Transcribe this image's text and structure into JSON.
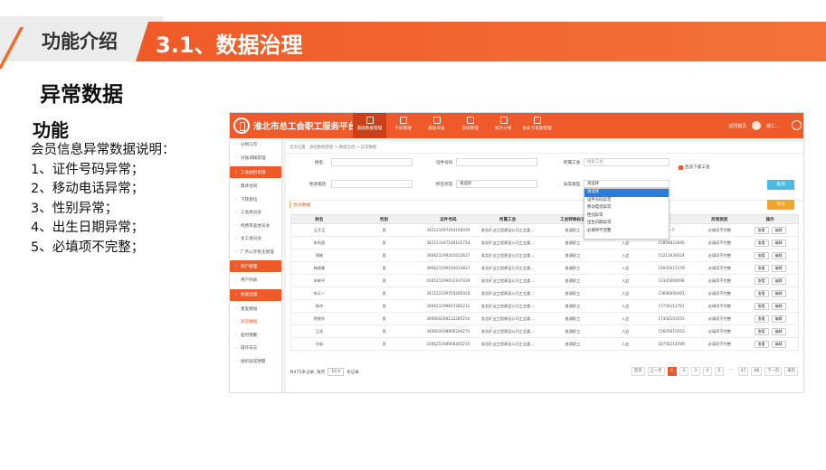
{
  "slide": {
    "section_label": "功能介绍",
    "section_title": "3.1、数据治理",
    "page_heading": "异常数据",
    "func_heading": "功能",
    "func_lines": [
      "会员信息异常数据说明：",
      "1、证件号码异常；",
      "2、移动电话异常；",
      "3、性别异常；",
      "4、出生日期异常；",
      "5、必填项不完整；"
    ]
  },
  "app": {
    "name": "淮北市总工会职工服务平台",
    "nav": [
      "基础数据管理",
      "干部管理",
      "基层单位",
      "活动管理",
      "统计分析",
      "会员卡发放管理"
    ],
    "nav_active": 0,
    "top_right": {
      "home": "返回首页",
      "user": "颜仁..."
    },
    "sidebar": [
      {
        "label": "分税工作",
        "type": "item"
      },
      {
        "label": "对账调拨管理",
        "type": "item"
      },
      {
        "label": "工会组织管理",
        "type": "head"
      },
      {
        "label": "集体合同",
        "type": "item"
      },
      {
        "label": "下辖单位",
        "type": "item"
      },
      {
        "label": "工会委员会",
        "type": "item"
      },
      {
        "label": "经费审查委员会",
        "type": "item"
      },
      {
        "label": "女工委员会",
        "type": "item"
      },
      {
        "label": "厂务公开民主管理",
        "type": "item"
      },
      {
        "label": "用户管理",
        "type": "head"
      },
      {
        "label": "用户列表",
        "type": "item"
      },
      {
        "label": "数据治理",
        "type": "head"
      },
      {
        "label": "重复数据",
        "type": "item"
      },
      {
        "label": "异常数据",
        "type": "current"
      },
      {
        "label": "超时预警",
        "type": "item"
      },
      {
        "label": "操作日志",
        "type": "item"
      },
      {
        "label": "组织异常预警",
        "type": "item"
      }
    ],
    "breadcrumb": "首页位置：基础数据管理 > 数据治理 > 异常数据",
    "form": {
      "name_label": "姓名",
      "cert_label": "证件号码",
      "union_label": "所属工会",
      "union_value": "搜索工会",
      "include_sub": "包含下级工会",
      "phone_label": "移动电话",
      "status_label": "所在状态",
      "status_value": "请选择",
      "abn_label": "异常类型",
      "abn_value": "请选择",
      "query_btn": "查询"
    },
    "dropdown": [
      "请选择",
      "证件号码异常",
      "移动电话异常",
      "性别异常",
      "出生日期异常",
      "必填项不完整"
    ],
    "section_title": "会员数据",
    "export_btn": "导出",
    "table": {
      "headers": [
        "姓名",
        "性别",
        "证件号码",
        "所属工会",
        "工会特殊标识",
        "",
        "",
        "异常类型",
        "操作"
      ],
      "rows": [
        [
          "王开玉",
          "男",
          "342121197204140039",
          "淮北矿业工程建设公司工会委...",
          "普通职工",
          "入会",
          "···7",
          "必填项不完整"
        ],
        [
          "朱尚昌",
          "男",
          "342121197108102714",
          "淮北矿业工程建设公司工会委...",
          "普通职工",
          "入会",
          "15856023666",
          "必填项不完整"
        ],
        [
          "周楠",
          "男",
          "340621199201012637",
          "淮北矿业工程建设公司工会委...",
          "普通职工",
          "入会",
          "15212636024",
          "必填项不完整"
        ],
        [
          "韩建春",
          "男",
          "340621199104014837",
          "淮北矿业工程建设公司工会委...",
          "普通职工",
          "入会",
          "15605615159",
          "必填项不完整"
        ],
        [
          "申继平",
          "男",
          "410521199012197039",
          "淮北矿业工程建设公司工会委...",
          "普通职工",
          "入会",
          "13335606098",
          "必填项不完整"
        ],
        [
          "朱天一",
          "男",
          "341122199703285019",
          "淮北矿业工程建设公司工会委...",
          "普通职工",
          "入会",
          "13696000491",
          "必填项不完整"
        ],
        [
          "杨冲",
          "男",
          "340621199607285211",
          "淮北矿业工程建设公司工会委...",
          "普通职工",
          "入会",
          "17756112761",
          "必填项不完整"
        ],
        [
          "贾建东",
          "男",
          "34060419811228521X",
          "淮北矿业工程建设公司工会委...",
          "普通职工",
          "入会",
          "17356103551",
          "必填项不完整"
        ],
        [
          "王成",
          "男",
          "340603198906240274",
          "淮北矿业工程建设公司工会委...",
          "普通职工",
          "入会",
          "15605610553",
          "必填项不完整"
        ],
        [
          "孙弟",
          "男",
          "34062119890826521X",
          "淮北矿业工程建设公司工会委...",
          "普通职工",
          "入会",
          "18756114599",
          "必填项不完整"
        ]
      ],
      "op_view": "查看",
      "op_edit": "编辑"
    },
    "footer": {
      "total": "共475条记录",
      "per_page_pre": "每页",
      "per_page": "10",
      "per_page_post": "条记录",
      "pages": [
        "首页",
        "上一页",
        "1",
        "2",
        "3",
        "4",
        "5",
        "···",
        "47",
        "48",
        "下一页",
        "末页"
      ],
      "active_page": "1"
    }
  }
}
